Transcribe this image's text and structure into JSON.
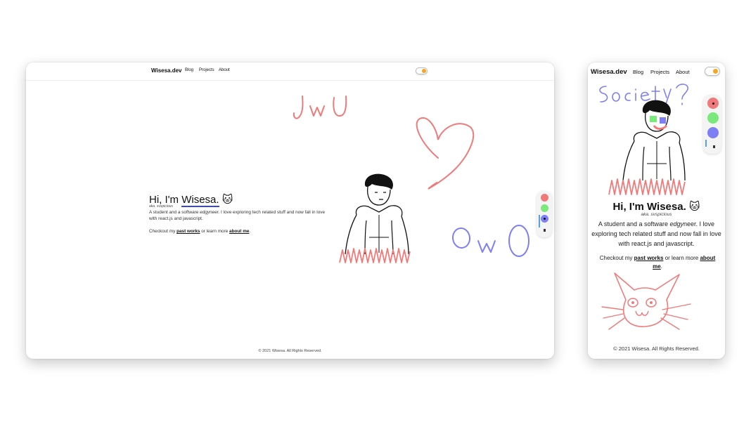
{
  "desktop": {
    "nav": {
      "logo": "Wisesa.dev",
      "links": [
        "Blog",
        "Projects",
        "About"
      ]
    },
    "hero": {
      "greeting": "Hi, I'm ",
      "name": "Wisesa.",
      "emoji": "🐱",
      "aka": "aka. svspicious",
      "desc_1": "A student and a software ",
      "desc_em": "edgy",
      "desc_2": "neer. I love exploring tech related stuff and now fall in love with react.js and javascript.",
      "check_1": "Checkout my ",
      "link_works": "past works",
      "check_2": " or learn more ",
      "link_about": "about me",
      "check_3": "."
    },
    "doodles": {
      "top": "JwU",
      "right": "OwO"
    },
    "footer": "© 2021 Wisesa. All Rights Reserved."
  },
  "mobile": {
    "nav": {
      "logo": "Wisesa.dev",
      "links": [
        "Blog",
        "Projects",
        "About"
      ]
    },
    "doodle_text": "Society?",
    "hero": {
      "greeting": "Hi, I'm Wisesa.",
      "emoji": "🐱",
      "aka": "aka. svspicious",
      "desc_1": "A student and a software ",
      "desc_em": "edgy",
      "desc_2": "neer. I love exploring tech related stuff and now fall in love with react.js and javascript.",
      "check_1": "Checkout my ",
      "link_works": "past works",
      "check_2": " or learn more ",
      "link_about": "about me",
      "check_3": "."
    },
    "footer": "© 2021 Wisesa. All Rights Reserved."
  },
  "palette": {
    "colors": [
      "#f07a7a",
      "#7ae87a",
      "#7f7ff5"
    ],
    "selected_desktop": "#7f7ff5",
    "selected_mobile": "#f07a7a",
    "tools": [
      "brush-size-slider",
      "eraser-icon"
    ]
  },
  "theme": {
    "toggle": "sun-icon",
    "accent": "#f5a623",
    "underline": "#3b45d8",
    "ink_red": "#f07a7a",
    "ink_blue": "#7f7ff5"
  }
}
